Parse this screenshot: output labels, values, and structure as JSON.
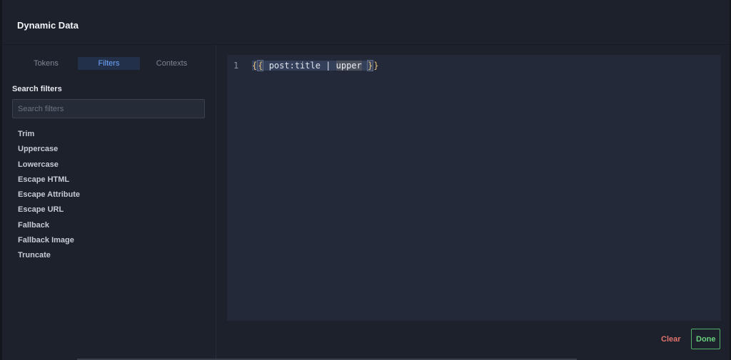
{
  "dialog": {
    "title": "Dynamic Data"
  },
  "sidebar": {
    "tabs": [
      {
        "label": "Tokens",
        "active": false
      },
      {
        "label": "Filters",
        "active": true
      },
      {
        "label": "Contexts",
        "active": false
      }
    ],
    "search": {
      "label": "Search filters",
      "placeholder": "Search filters",
      "value": ""
    },
    "filters": [
      "Trim",
      "Uppercase",
      "Lowercase",
      "Escape HTML",
      "Escape Attribute",
      "Escape URL",
      "Fallback",
      "Fallback Image",
      "Truncate"
    ]
  },
  "editor": {
    "line_number": "1",
    "tokens": {
      "open_outer": "{",
      "open_inner": "{",
      "space_pre": " ",
      "expr": "post:title | ",
      "filter": "upper",
      "space_post": " ",
      "close_inner": "}",
      "close_outer": "}"
    }
  },
  "footer": {
    "clear_label": "Clear",
    "done_label": "Done"
  },
  "colors": {
    "accent": "#6fa8ff",
    "danger": "#e0736e",
    "success": "#52b06a",
    "background": "#1c212b",
    "editor_bg": "#232938"
  }
}
